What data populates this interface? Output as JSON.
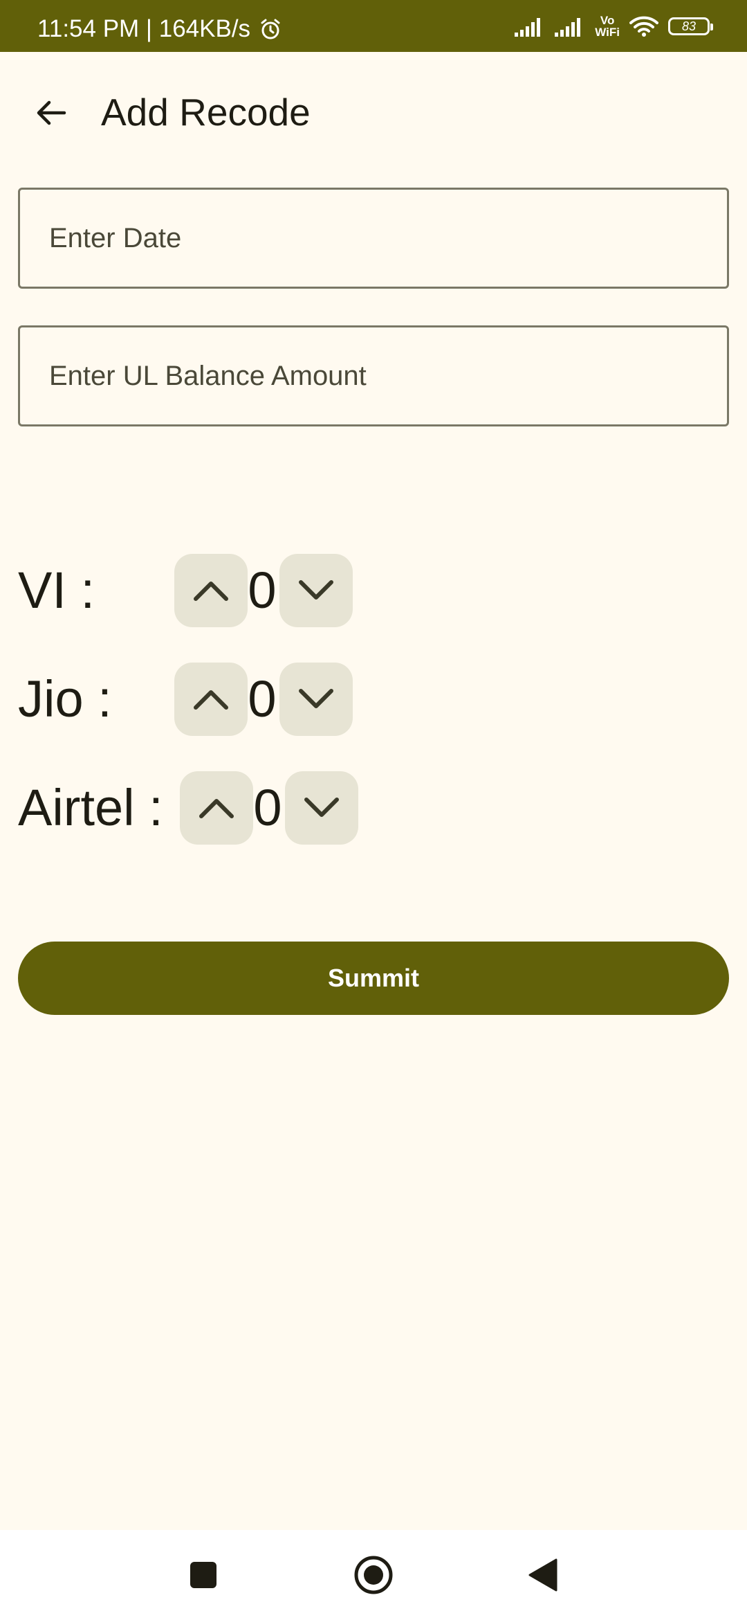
{
  "status_bar": {
    "time_speed": "11:54 PM | 164KB/s",
    "vowifi_top": "Vo",
    "vowifi_bottom": "WiFi",
    "battery": "83"
  },
  "app_bar": {
    "title": "Add Recode",
    "back_icon": "arrow-left-icon"
  },
  "form": {
    "date_field": {
      "value": "",
      "placeholder": "Enter Date"
    },
    "balance_field": {
      "value": "",
      "placeholder": "Enter UL Balance Amount"
    }
  },
  "counters": [
    {
      "label": "VI :",
      "value": "0"
    },
    {
      "label": "Jio :",
      "value": "0"
    },
    {
      "label": "Airtel :",
      "value": "0"
    }
  ],
  "submit_label": "Summit",
  "colors": {
    "primary": "#616009",
    "background": "#fffaf0",
    "stepper_bg": "#e7e4d4",
    "outline": "#7a7866",
    "text": "#1e1c13"
  },
  "nav_bar": {
    "recents_icon": "square-icon",
    "home_icon": "circle-home-icon",
    "back_icon": "triangle-back-icon"
  }
}
